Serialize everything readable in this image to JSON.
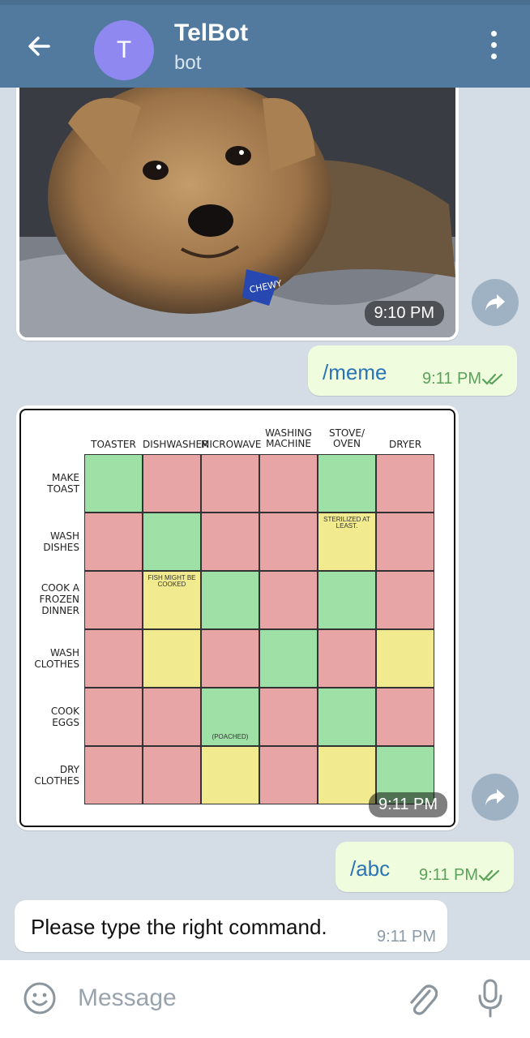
{
  "header": {
    "avatar_letter": "T",
    "title": "TelBot",
    "subtitle": "bot",
    "back_icon": "arrow-left-icon",
    "menu_icon": "more-vert-icon"
  },
  "messages": {
    "photo1": {
      "time": "9:10 PM",
      "tag": "CHEWY"
    },
    "out1": {
      "text": "/meme",
      "time": "9:11 PM"
    },
    "photo2": {
      "time": "9:11 PM",
      "columns": [
        "TOASTER",
        "DISHWASHER",
        "MICROWAVE",
        "WASHING MACHINE",
        "STOVE/ OVEN",
        "DRYER"
      ],
      "rows": [
        "MAKE TOAST",
        "WASH DISHES",
        "COOK A FROZEN DINNER",
        "WASH CLOTHES",
        "COOK EGGS",
        "DRY CLOTHES"
      ],
      "notes": {
        "sterilized": "STERILIZED AT LEAST.",
        "fish": "FISH MIGHT BE COOKED",
        "poached": "(POACHED)"
      }
    },
    "out2": {
      "text": "/abc",
      "time": "9:11 PM"
    },
    "in_text": {
      "text": "Please type the right command.",
      "time": "9:11 PM"
    }
  },
  "input": {
    "placeholder": "Message"
  },
  "colors": {
    "header_bg": "#52799e",
    "avatar_bg": "#8f88f0",
    "outgoing_bubble": "#effdde",
    "chat_bg": "#d4dde6",
    "green_cell": "#9fe0a6",
    "red_cell": "#e8a5a5",
    "yellow_cell": "#f1ea8f"
  }
}
